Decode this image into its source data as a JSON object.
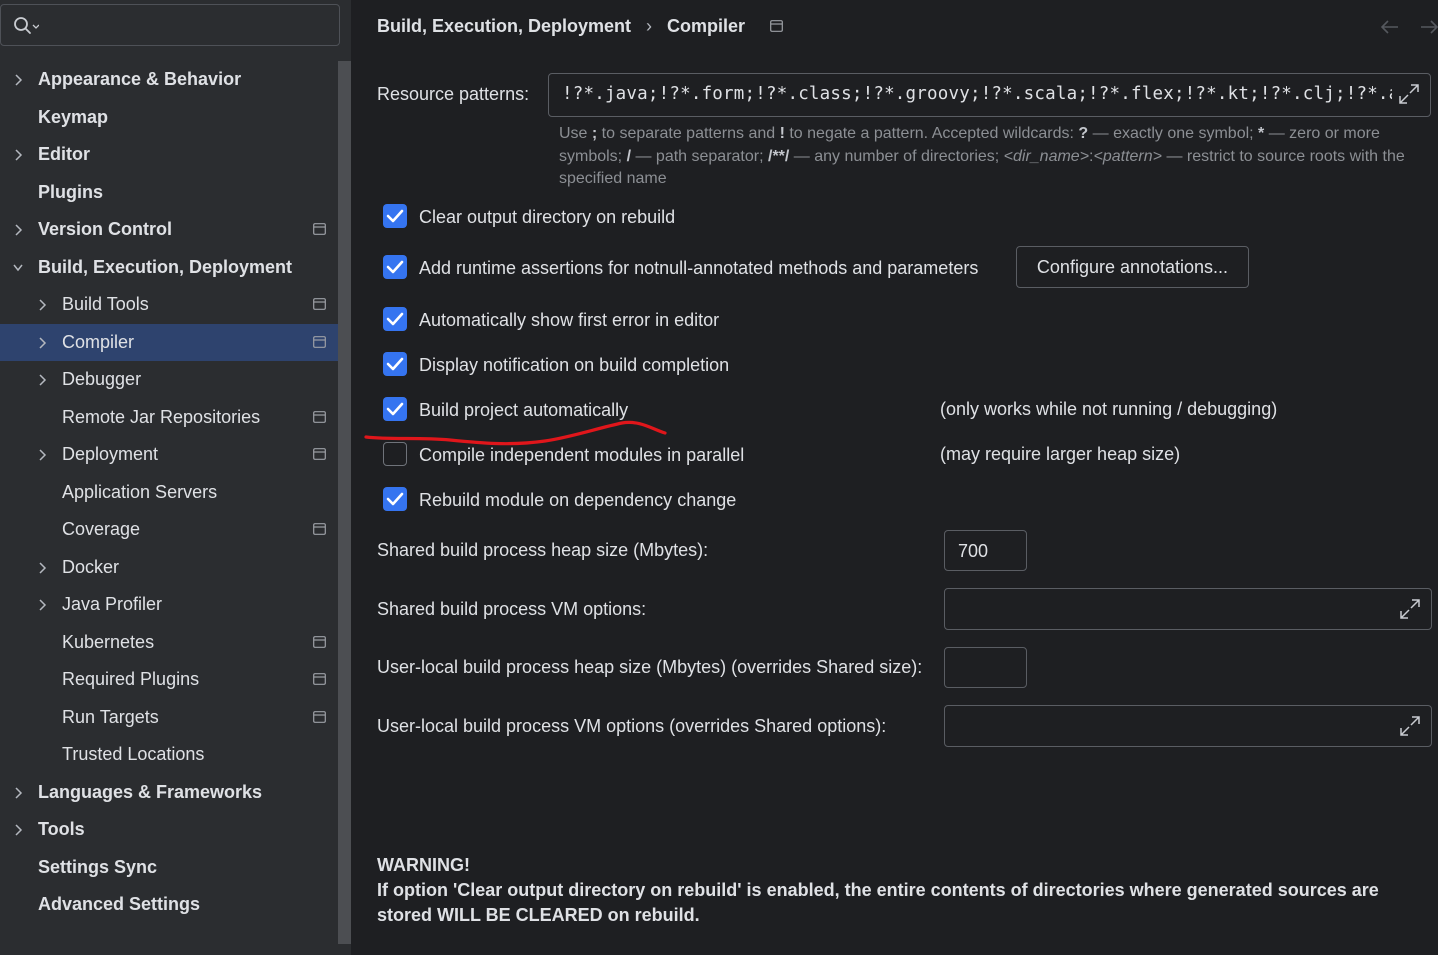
{
  "search": {
    "placeholder": "",
    "value": ""
  },
  "sidebar": {
    "items": [
      {
        "label": "Appearance & Behavior",
        "level": 0,
        "chevron": "right",
        "project_icon": false,
        "selected": false
      },
      {
        "label": "Keymap",
        "level": 0,
        "chevron": "none",
        "project_icon": false,
        "selected": false
      },
      {
        "label": "Editor",
        "level": 0,
        "chevron": "right",
        "project_icon": false,
        "selected": false
      },
      {
        "label": "Plugins",
        "level": 0,
        "chevron": "none",
        "project_icon": false,
        "selected": false
      },
      {
        "label": "Version Control",
        "level": 0,
        "chevron": "right",
        "project_icon": true,
        "selected": false
      },
      {
        "label": "Build, Execution, Deployment",
        "level": 0,
        "chevron": "down",
        "project_icon": false,
        "selected": false
      },
      {
        "label": "Build Tools",
        "level": 1,
        "chevron": "right",
        "project_icon": true,
        "selected": false
      },
      {
        "label": "Compiler",
        "level": 1,
        "chevron": "right",
        "project_icon": true,
        "selected": true
      },
      {
        "label": "Debugger",
        "level": 1,
        "chevron": "right",
        "project_icon": false,
        "selected": false
      },
      {
        "label": "Remote Jar Repositories",
        "level": 1,
        "chevron": "none",
        "project_icon": true,
        "selected": false
      },
      {
        "label": "Deployment",
        "level": 1,
        "chevron": "right",
        "project_icon": true,
        "selected": false
      },
      {
        "label": "Application Servers",
        "level": 1,
        "chevron": "none",
        "project_icon": false,
        "selected": false
      },
      {
        "label": "Coverage",
        "level": 1,
        "chevron": "none",
        "project_icon": true,
        "selected": false
      },
      {
        "label": "Docker",
        "level": 1,
        "chevron": "right",
        "project_icon": false,
        "selected": false
      },
      {
        "label": "Java Profiler",
        "level": 1,
        "chevron": "right",
        "project_icon": false,
        "selected": false
      },
      {
        "label": "Kubernetes",
        "level": 1,
        "chevron": "none",
        "project_icon": true,
        "selected": false
      },
      {
        "label": "Required Plugins",
        "level": 1,
        "chevron": "none",
        "project_icon": true,
        "selected": false
      },
      {
        "label": "Run Targets",
        "level": 1,
        "chevron": "none",
        "project_icon": true,
        "selected": false
      },
      {
        "label": "Trusted Locations",
        "level": 1,
        "chevron": "none",
        "project_icon": false,
        "selected": false
      },
      {
        "label": "Languages & Frameworks",
        "level": 0,
        "chevron": "right",
        "project_icon": false,
        "selected": false
      },
      {
        "label": "Tools",
        "level": 0,
        "chevron": "right",
        "project_icon": false,
        "selected": false
      },
      {
        "label": "Settings Sync",
        "level": 0,
        "chevron": "none",
        "project_icon": false,
        "selected": false
      },
      {
        "label": "Advanced Settings",
        "level": 0,
        "chevron": "none",
        "project_icon": false,
        "selected": false
      }
    ]
  },
  "header": {
    "breadcrumb_parent": "Build, Execution, Deployment",
    "breadcrumb_separator": "›",
    "breadcrumb_current": "Compiler"
  },
  "compiler": {
    "resource_patterns_label": "Resource patterns:",
    "resource_patterns_value": "!?*.java;!?*.form;!?*.class;!?*.groovy;!?*.scala;!?*.flex;!?*.kt;!?*.clj;!?*.aj",
    "hint": {
      "t1": "Use ",
      "semicolon": ";",
      "t2": " to separate patterns and ",
      "bang": "!",
      "t3": " to negate a pattern. Accepted wildcards: ",
      "q": "?",
      "t4": " — exactly one symbol; ",
      "star": "*",
      "t5": " — zero or more symbols; ",
      "slash": "/",
      "t6": " — path separator; ",
      "anydir": "/**/",
      "t7": " — any number of directories; ",
      "dirname": "<dir_name>",
      "colon": ":",
      "pattern": "<pattern>",
      "t8": " — restrict to source roots with the specified name"
    },
    "options": [
      {
        "label": "Clear output directory on rebuild",
        "checked": true
      },
      {
        "label": "Add runtime assertions for notnull-annotated methods and parameters",
        "checked": true
      },
      {
        "label": "Automatically show first error in editor",
        "checked": true
      },
      {
        "label": "Display notification on build completion",
        "checked": true
      },
      {
        "label": "Build project automatically",
        "checked": true,
        "note": "(only works while not running / debugging)"
      },
      {
        "label": "Compile independent modules in parallel",
        "checked": false,
        "note": "(may require larger heap size)"
      },
      {
        "label": "Rebuild module on dependency change",
        "checked": true
      }
    ],
    "configure_button": "Configure annotations...",
    "shared_heap_label": "Shared build process heap size (Mbytes):",
    "shared_heap_value": "700",
    "shared_vm_label": "Shared build process VM options:",
    "shared_vm_value": "",
    "user_heap_label": "User-local build process heap size (Mbytes) (overrides Shared size):",
    "user_heap_value": "",
    "user_vm_label": "User-local build process VM options (overrides Shared options):",
    "user_vm_value": "",
    "warning_title": "WARNING!",
    "warning_text": "If option 'Clear output directory on rebuild' is enabled, the entire contents of directories where generated sources are stored WILL BE CLEARED on rebuild."
  },
  "colors": {
    "accent": "#3574f0",
    "selection": "#2e436e",
    "annotation_stroke": "#e0161b"
  },
  "icons": {
    "search": "search-icon",
    "chevron_right": "chevron-right-icon",
    "chevron_down": "chevron-down-icon",
    "project_scope": "project-scope-icon",
    "expand": "expand-icon",
    "back": "back-arrow-icon",
    "forward": "forward-arrow-icon",
    "check": "check-icon"
  }
}
